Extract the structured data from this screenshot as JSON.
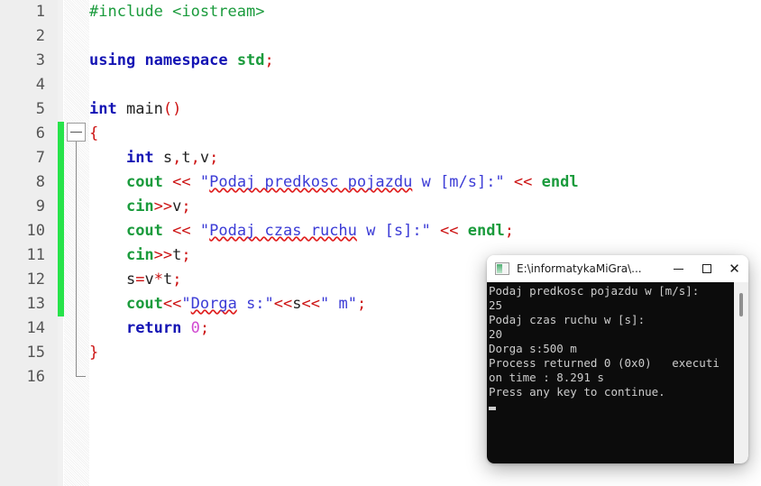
{
  "editor": {
    "name": "code-editor",
    "language": "cpp",
    "colors": {
      "background": "#ffffff",
      "gutter": "#eeeeee",
      "change_bar": "#27e34a",
      "preprocessor": "#1a9b3c",
      "keyword": "#1414b4",
      "string": "#3b3bd6",
      "operator": "#cc1111",
      "number": "#d14ad1",
      "spellcheck_underline": "#e02020"
    },
    "line_numbers": [
      "1",
      "2",
      "3",
      "4",
      "5",
      "6",
      "7",
      "8",
      "9",
      "10",
      "11",
      "12",
      "13",
      "14",
      "15",
      "16"
    ],
    "lines": [
      {
        "n": "1",
        "tokens": [
          {
            "t": "#include <iostream>",
            "c": "c-pre"
          }
        ]
      },
      {
        "n": "2",
        "tokens": []
      },
      {
        "n": "3",
        "tokens": [
          {
            "t": "using",
            "c": "c-kw"
          },
          {
            "t": " ",
            "c": "c-plain"
          },
          {
            "t": "namespace",
            "c": "c-kw"
          },
          {
            "t": " ",
            "c": "c-plain"
          },
          {
            "t": "std",
            "c": "c-std"
          },
          {
            "t": ";",
            "c": "c-punc"
          }
        ]
      },
      {
        "n": "4",
        "tokens": []
      },
      {
        "n": "5",
        "tokens": [
          {
            "t": "int",
            "c": "c-type"
          },
          {
            "t": " main",
            "c": "c-plain"
          },
          {
            "t": "()",
            "c": "c-punc"
          }
        ]
      },
      {
        "n": "6",
        "tokens": [
          {
            "t": "{",
            "c": "c-brace"
          }
        ]
      },
      {
        "n": "7",
        "tokens": [
          {
            "t": "    ",
            "c": "c-plain"
          },
          {
            "t": "int",
            "c": "c-type"
          },
          {
            "t": " s",
            "c": "c-plain"
          },
          {
            "t": ",",
            "c": "c-punc"
          },
          {
            "t": "t",
            "c": "c-plain"
          },
          {
            "t": ",",
            "c": "c-punc"
          },
          {
            "t": "v",
            "c": "c-plain"
          },
          {
            "t": ";",
            "c": "c-punc"
          }
        ]
      },
      {
        "n": "8",
        "tokens": [
          {
            "t": "    ",
            "c": "c-plain"
          },
          {
            "t": "cout",
            "c": "c-io"
          },
          {
            "t": " ",
            "c": "c-plain"
          },
          {
            "t": "<<",
            "c": "c-op"
          },
          {
            "t": " ",
            "c": "c-plain"
          },
          {
            "t": "\"",
            "c": "c-str"
          },
          {
            "t": "Podaj predkosc pojazdu",
            "c": "c-str spell"
          },
          {
            "t": " w [m/s]:\"",
            "c": "c-str"
          },
          {
            "t": " ",
            "c": "c-plain"
          },
          {
            "t": "<<",
            "c": "c-op"
          },
          {
            "t": " ",
            "c": "c-plain"
          },
          {
            "t": "endl",
            "c": "c-io"
          }
        ]
      },
      {
        "n": "9",
        "tokens": [
          {
            "t": "    ",
            "c": "c-plain"
          },
          {
            "t": "cin",
            "c": "c-io"
          },
          {
            "t": ">>",
            "c": "c-op"
          },
          {
            "t": "v",
            "c": "c-plain"
          },
          {
            "t": ";",
            "c": "c-punc"
          }
        ]
      },
      {
        "n": "10",
        "tokens": [
          {
            "t": "    ",
            "c": "c-plain"
          },
          {
            "t": "cout",
            "c": "c-io"
          },
          {
            "t": " ",
            "c": "c-plain"
          },
          {
            "t": "<<",
            "c": "c-op"
          },
          {
            "t": " ",
            "c": "c-plain"
          },
          {
            "t": "\"",
            "c": "c-str"
          },
          {
            "t": "Podaj czas ruchu",
            "c": "c-str spell"
          },
          {
            "t": " w [s]:\"",
            "c": "c-str"
          },
          {
            "t": " ",
            "c": "c-plain"
          },
          {
            "t": "<<",
            "c": "c-op"
          },
          {
            "t": " ",
            "c": "c-plain"
          },
          {
            "t": "endl",
            "c": "c-io"
          },
          {
            "t": ";",
            "c": "c-punc"
          }
        ]
      },
      {
        "n": "11",
        "tokens": [
          {
            "t": "    ",
            "c": "c-plain"
          },
          {
            "t": "cin",
            "c": "c-io"
          },
          {
            "t": ">>",
            "c": "c-op"
          },
          {
            "t": "t",
            "c": "c-plain"
          },
          {
            "t": ";",
            "c": "c-punc"
          }
        ]
      },
      {
        "n": "12",
        "tokens": [
          {
            "t": "    s",
            "c": "c-plain"
          },
          {
            "t": "=",
            "c": "c-op"
          },
          {
            "t": "v",
            "c": "c-plain"
          },
          {
            "t": "*",
            "c": "c-op"
          },
          {
            "t": "t",
            "c": "c-plain"
          },
          {
            "t": ";",
            "c": "c-punc"
          }
        ]
      },
      {
        "n": "13",
        "tokens": [
          {
            "t": "    ",
            "c": "c-plain"
          },
          {
            "t": "cout",
            "c": "c-io"
          },
          {
            "t": "<<",
            "c": "c-op"
          },
          {
            "t": "\"",
            "c": "c-str"
          },
          {
            "t": "Dorga",
            "c": "c-str spell"
          },
          {
            "t": " s:\"",
            "c": "c-str"
          },
          {
            "t": "<<",
            "c": "c-op"
          },
          {
            "t": "s",
            "c": "c-plain"
          },
          {
            "t": "<<",
            "c": "c-op"
          },
          {
            "t": "\" m\"",
            "c": "c-str"
          },
          {
            "t": ";",
            "c": "c-punc"
          }
        ]
      },
      {
        "n": "14",
        "tokens": [
          {
            "t": "    ",
            "c": "c-plain"
          },
          {
            "t": "return",
            "c": "c-kw"
          },
          {
            "t": " ",
            "c": "c-plain"
          },
          {
            "t": "0",
            "c": "c-num"
          },
          {
            "t": ";",
            "c": "c-punc"
          }
        ]
      },
      {
        "n": "15",
        "tokens": [
          {
            "t": "}",
            "c": "c-brace"
          }
        ]
      },
      {
        "n": "16",
        "tokens": []
      }
    ]
  },
  "console": {
    "title": "E:\\informatykaMiGra\\...",
    "app_icon": "console-icon",
    "window_controls": {
      "minimize": "—",
      "maximize": "□",
      "close": "✕"
    },
    "output_lines": [
      "Podaj predkosc pojazdu w [m/s]:",
      "25",
      "Podaj czas ruchu w [s]:",
      "20",
      "Dorga s:500 m",
      "Process returned 0 (0x0)   executi",
      "on time : 8.291 s",
      "Press any key to continue."
    ],
    "colors": {
      "background": "#0c0c0c",
      "text": "#cccccc",
      "titlebar": "#ffffff"
    }
  }
}
